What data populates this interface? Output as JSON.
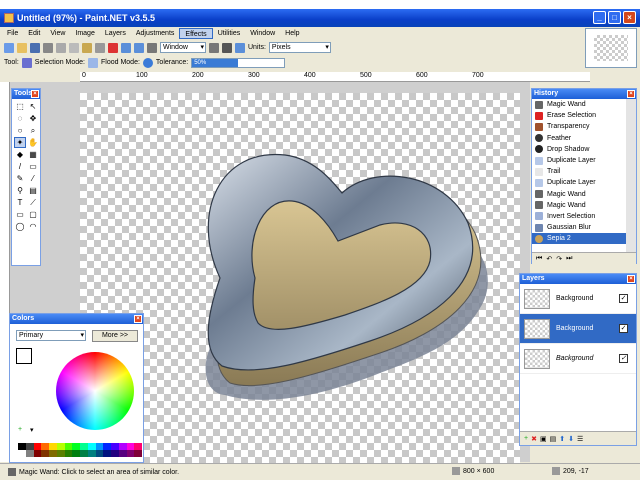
{
  "window": {
    "title": "Untitled (97%) - Paint.NET v3.5.5"
  },
  "menu": {
    "items": [
      "File",
      "Edit",
      "View",
      "Image",
      "Layers",
      "Adjustments",
      "Effects",
      "Utilities",
      "Window",
      "Help"
    ],
    "active": "Effects"
  },
  "toolbar": {
    "zoom_value": "Window",
    "units_label": "Units:",
    "units_value": "Pixels"
  },
  "tool_bar": {
    "tool_label": "Tool:",
    "selection_mode_label": "Selection Mode:",
    "flood_mode_label": "Flood Mode:",
    "tolerance_label": "Tolerance:",
    "tolerance_value": "50%",
    "tolerance_fraction": 0.5
  },
  "ruler": {
    "marks": [
      "0",
      "100",
      "200",
      "300",
      "400",
      "500",
      "600",
      "700"
    ]
  },
  "tools_panel": {
    "title": "Tools"
  },
  "history_panel": {
    "title": "History",
    "items": [
      "Magic Wand",
      "Erase Selection",
      "Transparency",
      "Feather",
      "Drop Shadow",
      "Duplicate Layer",
      "Trail",
      "Duplicate Layer",
      "Magic Wand",
      "Magic Wand",
      "Invert Selection",
      "Gaussian Blur",
      "Sepia 2"
    ],
    "selected_index": 12
  },
  "layers_panel": {
    "title": "Layers",
    "items": [
      "Background",
      "Background",
      "Background"
    ],
    "selected_index": 1
  },
  "colors_panel": {
    "title": "Colors",
    "mode": "Primary",
    "more_button": "More >>"
  },
  "status": {
    "text": "Magic Wand: Click to select an area of similar color.",
    "image_size": "800 × 600",
    "cursor_pos": "209, -17"
  }
}
